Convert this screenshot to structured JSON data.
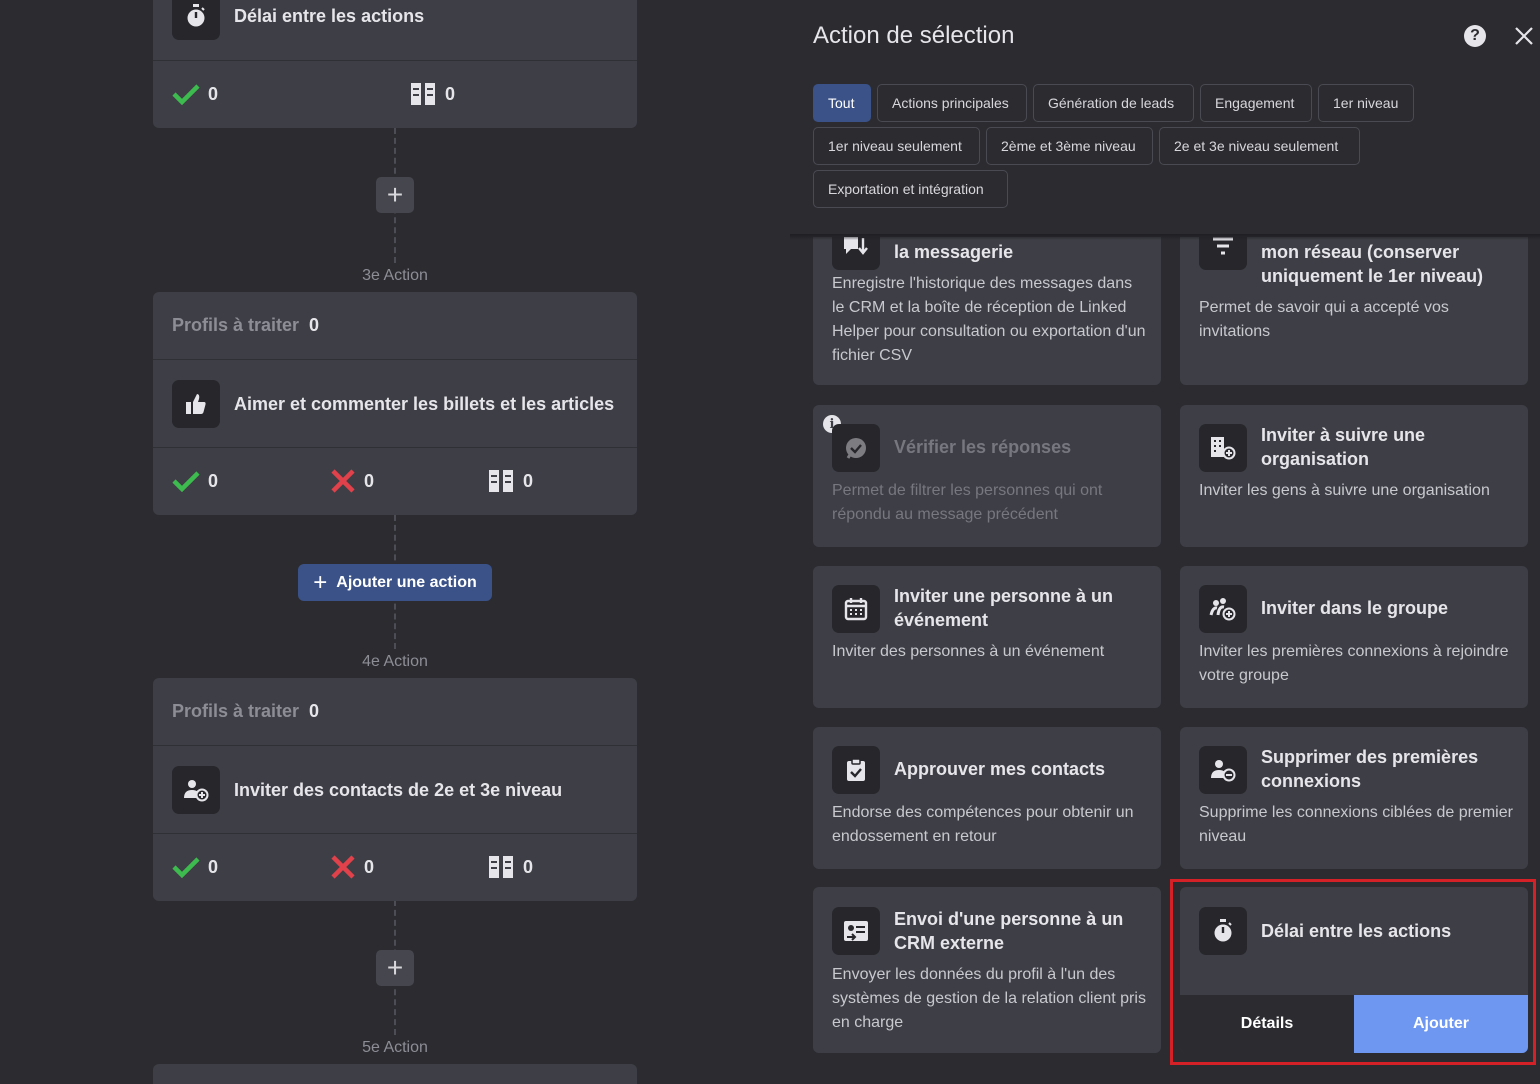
{
  "workflow": {
    "card1": {
      "action_title": "Délai entre les actions",
      "stat_success": "0",
      "stat_skipped": "0"
    },
    "label3": "3e Action",
    "card2": {
      "profils_label": "Profils à traiter",
      "profils_count": "0",
      "action_title": "Aimer et commenter les billets et les articles",
      "stat_success": "0",
      "stat_failed": "0",
      "stat_skipped": "0"
    },
    "add_action_label": "Ajouter une action",
    "label4": "4e Action",
    "card3": {
      "profils_label": "Profils à traiter",
      "profils_count": "0",
      "action_title": "Inviter des contacts de 2e et 3e niveau",
      "stat_success": "0",
      "stat_failed": "0",
      "stat_skipped": "0"
    },
    "label5": "5e Action",
    "plus_symbol": "+"
  },
  "panel": {
    "title": "Action de sélection",
    "help_symbol": "?",
    "filters": [
      "Tout",
      "Actions principales",
      "Génération de leads",
      "Engagement",
      "1er niveau",
      "1er niveau seulement",
      "2ème et 3ème niveau",
      "2e et 3e niveau seulement",
      "Exportation et intégration"
    ],
    "active_filter": "Tout",
    "cards": [
      {
        "title": "la messagerie",
        "desc": "Enregistre l'historique des messages dans le CRM et la boîte de réception de Linked Helper pour consultation ou exportation d'un fichier CSV",
        "icon": "messages-sync-icon"
      },
      {
        "title": "mon réseau (conserver uniquement le 1er niveau)",
        "desc": "Permet de savoir qui a accepté vos invitations",
        "icon": "filter-icon"
      },
      {
        "title": "Vérifier les réponses",
        "desc": "Permet de filtrer les personnes qui ont répondu au message précédent",
        "icon": "chat-check-icon",
        "disabled": true,
        "info": "i"
      },
      {
        "title": "Inviter à suivre une organisation",
        "desc": "Inviter les gens à suivre une organisation",
        "icon": "building-add-icon"
      },
      {
        "title": "Inviter une personne à un événement",
        "desc": "Inviter des personnes à un événement",
        "icon": "calendar-icon"
      },
      {
        "title": "Inviter dans le groupe",
        "desc": "Inviter les premières connexions à rejoindre votre groupe",
        "icon": "group-add-icon"
      },
      {
        "title": "Approuver mes contacts",
        "desc": "Endorse des compétences pour obtenir un endossement en retour",
        "icon": "clipboard-check-icon"
      },
      {
        "title": "Supprimer des premières connexions",
        "desc": "Supprime les connexions ciblées de premier niveau",
        "icon": "user-remove-icon"
      },
      {
        "title": "Envoi d'une personne à un CRM externe",
        "desc": "Envoyer les données du profil à l'un des systèmes de gestion de la relation client pris en charge",
        "icon": "crm-export-icon"
      },
      {
        "title": "Délai entre les actions",
        "icon": "stopwatch-icon"
      }
    ],
    "details_label": "Détails",
    "add_label": "Ajouter"
  },
  "colors": {
    "accent": "#3a5288",
    "add_button": "#6d97f0",
    "success": "#3dbb4e",
    "danger": "#e0414a",
    "highlight": "#d42027"
  }
}
